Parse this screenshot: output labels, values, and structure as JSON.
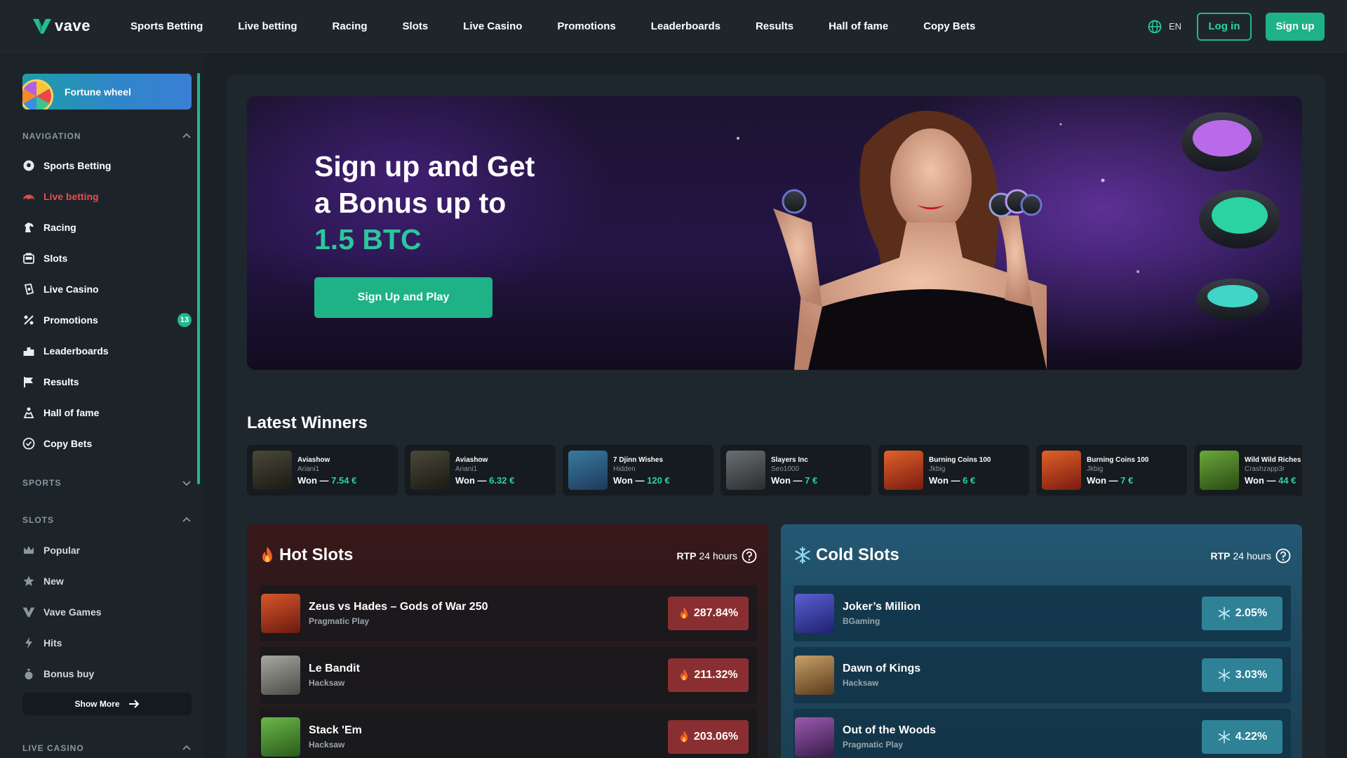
{
  "brand": {
    "name": "vave",
    "accent": "#1fb286",
    "live_color": "#f2484c"
  },
  "header": {
    "nav": [
      "Sports Betting",
      "Live betting",
      "Racing",
      "Slots",
      "Live Casino",
      "Promotions",
      "Leaderboards",
      "Results",
      "Hall of fame",
      "Copy Bets"
    ],
    "lang": "EN",
    "login": "Log in",
    "signup": "Sign up"
  },
  "sidebar": {
    "fortune": "Fortune wheel",
    "navigation_title": "NAVIGATION",
    "nav_items": [
      {
        "label": "Sports Betting",
        "icon": "soccer-ball-icon"
      },
      {
        "label": "Live betting",
        "icon": "live-signal-icon"
      },
      {
        "label": "Racing",
        "icon": "horse-icon"
      },
      {
        "label": "Slots",
        "icon": "slot-machine-icon"
      },
      {
        "label": "Live Casino",
        "icon": "chip-icon"
      },
      {
        "label": "Promotions",
        "icon": "gift-icon",
        "badge": "13"
      },
      {
        "label": "Leaderboards",
        "icon": "podium-icon"
      },
      {
        "label": "Results",
        "icon": "flag-icon"
      },
      {
        "label": "Hall of fame",
        "icon": "trophy-icon"
      },
      {
        "label": "Copy Bets",
        "icon": "copy-check-icon"
      }
    ],
    "sports_title": "SPORTS",
    "slots_title": "SLOTS",
    "slot_items": [
      {
        "label": "Popular",
        "icon": "crown-icon"
      },
      {
        "label": "New",
        "icon": "star-icon"
      },
      {
        "label": "Vave Games",
        "icon": "vave-logo-icon"
      },
      {
        "label": "Hits",
        "icon": "lightning-icon"
      },
      {
        "label": "Bonus buy",
        "icon": "money-bag-icon"
      }
    ],
    "show_more": "Show More",
    "live_casino_title": "LIVE CASINO"
  },
  "hero": {
    "line1": "Sign up and Get",
    "line2": "a Bonus up to",
    "highlight": "1.5 BTC",
    "cta": "Sign Up and Play"
  },
  "latest_winners": {
    "title": "Latest Winners",
    "items": [
      {
        "game": "Aviashow",
        "user": "Ariani1",
        "won": "Won —",
        "amount": "7.54 €",
        "color": "#3a3a2e"
      },
      {
        "game": "Aviashow",
        "user": "Ariani1",
        "won": "Won —",
        "amount": "6.32 €",
        "color": "#3a3a2e"
      },
      {
        "game": "7 Djinn Wishes",
        "user": "Hidden",
        "won": "Won —",
        "amount": "120 €",
        "color": "#2b5a7a"
      },
      {
        "game": "Slayers Inc",
        "user": "Seo1000",
        "won": "Won —",
        "amount": "7 €",
        "color": "#4a4f52"
      },
      {
        "game": "Burning Coins 100",
        "user": "Jkbig",
        "won": "Won —",
        "amount": "6 €",
        "color": "#b8321c"
      },
      {
        "game": "Burning Coins 100",
        "user": "Jkbig",
        "won": "Won —",
        "amount": "7 €",
        "color": "#b8321c"
      },
      {
        "game": "Wild Wild Riches",
        "user": "Crashzapp3r",
        "won": "Won —",
        "amount": "44 €",
        "color": "#3f7a2a"
      }
    ]
  },
  "hot_slots": {
    "title": "Hot Slots",
    "rtp_label": "RTP",
    "rtp_period": "24 hours",
    "items": [
      {
        "name": "Zeus vs Hades – Gods of War 250",
        "provider": "Pragmatic Play",
        "value": "287.84%",
        "color": "#b0401f"
      },
      {
        "name": "Le Bandit",
        "provider": "Hacksaw",
        "value": "211.32%",
        "color": "#8a8a86"
      },
      {
        "name": "Stack 'Em",
        "provider": "Hacksaw",
        "value": "203.06%",
        "color": "#4c8f3a"
      }
    ]
  },
  "cold_slots": {
    "title": "Cold Slots",
    "rtp_label": "RTP",
    "rtp_period": "24 hours",
    "items": [
      {
        "name": "Joker’s Million",
        "provider": "BGaming",
        "value": "2.05%",
        "color": "#3a3fa0"
      },
      {
        "name": "Dawn of Kings",
        "provider": "Hacksaw",
        "value": "3.03%",
        "color": "#9a7a4a"
      },
      {
        "name": "Out of the Woods",
        "provider": "Pragmatic Play",
        "value": "4.22%",
        "color": "#6a3a7a"
      }
    ]
  }
}
